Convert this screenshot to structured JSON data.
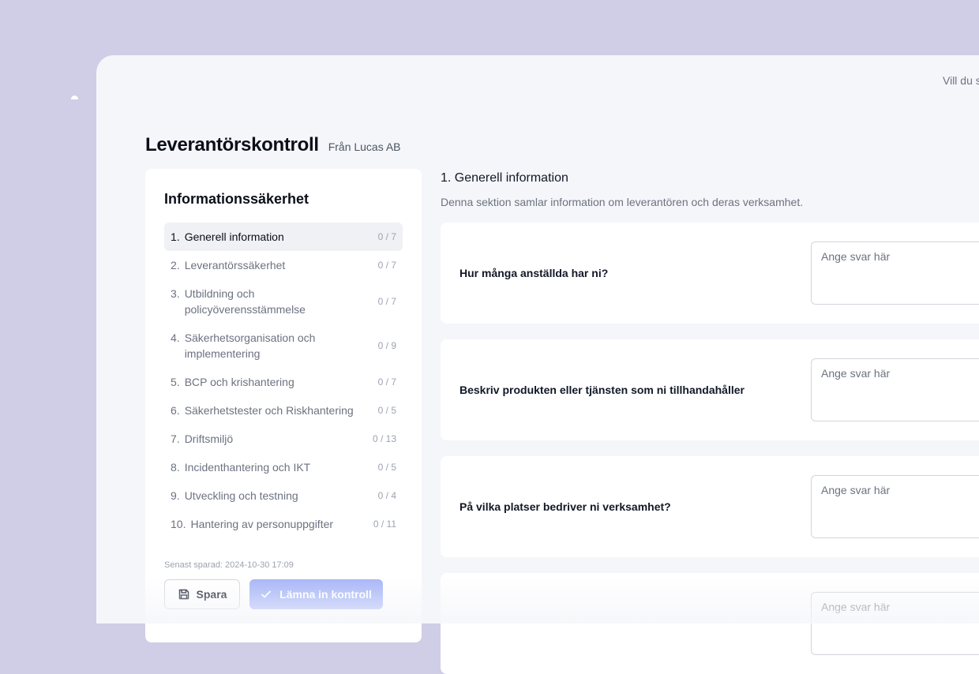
{
  "top_text": "Vill du s",
  "header": {
    "title": "Leverantörskontroll",
    "from": "Från Lucas AB"
  },
  "sidebar": {
    "heading": "Informationssäkerhet",
    "items": [
      {
        "num": "1.",
        "label": "Generell information",
        "count": "0 / 7",
        "active": true
      },
      {
        "num": "2.",
        "label": "Leverantörssäkerhet",
        "count": "0 / 7"
      },
      {
        "num": "3.",
        "label": "Utbildning och policyöverensstämmelse",
        "count": "0 / 7"
      },
      {
        "num": "4.",
        "label": "Säkerhetsorganisation och implementering",
        "count": "0 / 9"
      },
      {
        "num": "5.",
        "label": "BCP och krishantering",
        "count": "0 / 7"
      },
      {
        "num": "6.",
        "label": "Säkerhetstester och Riskhantering",
        "count": "0 / 5"
      },
      {
        "num": "7.",
        "label": "Driftsmiljö",
        "count": "0 / 13"
      },
      {
        "num": "8.",
        "label": "Incidenthantering och IKT",
        "count": "0 / 5"
      },
      {
        "num": "9.",
        "label": "Utveckling och testning",
        "count": "0 / 4"
      },
      {
        "num": "10.",
        "label": "Hantering av personuppgifter",
        "count": "0 / 11"
      }
    ],
    "saved_text": "Senast sparad: 2024-10-30 17:09",
    "save_label": "Spara",
    "submit_label": "Lämna in kontroll"
  },
  "main": {
    "section_title": "1. Generell information",
    "section_desc": "Denna sektion samlar information om leverantören och deras verksamhet.",
    "questions": [
      {
        "text": "Hur många anställda har ni?",
        "placeholder": "Ange svar här"
      },
      {
        "text": "Beskriv produkten eller tjänsten som ni tillhandahåller",
        "placeholder": "Ange svar här"
      },
      {
        "text": "På vilka platser bedriver ni verksamhet?",
        "placeholder": "Ange svar här"
      },
      {
        "text": "",
        "placeholder": "Ange svar här"
      }
    ]
  },
  "colors": {
    "background": "#d0cde6",
    "panel": "#f5f6fa",
    "accent_disabled": "#a5b4f8"
  }
}
